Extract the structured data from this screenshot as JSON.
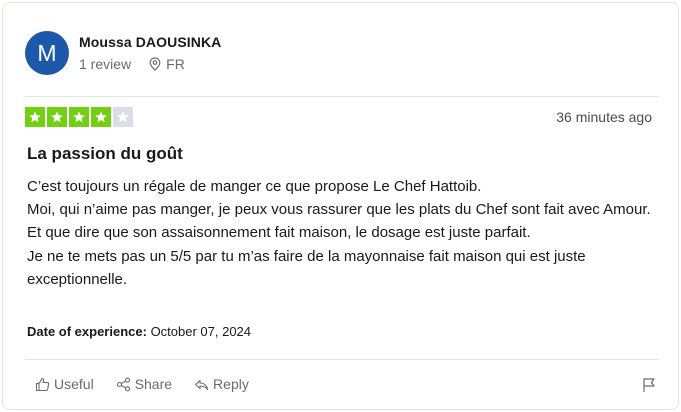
{
  "reviewer": {
    "initial": "M",
    "name": "Moussa DAOUSINKA",
    "reviews": "1 review",
    "country": "FR",
    "avatar_color": "#1d59a8"
  },
  "rating": {
    "value": 4,
    "max": 5,
    "filled_color": "#73cf11",
    "empty_color": "#dcdce6"
  },
  "time": "36 minutes ago",
  "title": "La passion du goût",
  "body": [
    "C’est toujours un régale de manger ce que propose Le Chef Hattoib.",
    "Moi, qui n’aime pas manger, je peux vous rassurer que les plats du Chef sont fait avec Amour. Et que dire que son assaisonnement fait maison, le dosage est juste parfait.",
    "Je ne te mets pas un 5/5 par tu m’as faire de la mayonnaise fait maison qui est juste exceptionnelle."
  ],
  "experience": {
    "label": "Date of experience:",
    "date": "October 07, 2024"
  },
  "actions": {
    "useful": "Useful",
    "share": "Share",
    "reply": "Reply"
  },
  "icons": {
    "location": "location-pin-icon",
    "useful": "thumbs-up-icon",
    "share": "share-icon",
    "reply": "reply-arrow-icon",
    "flag": "flag-icon",
    "star": "star-icon"
  }
}
